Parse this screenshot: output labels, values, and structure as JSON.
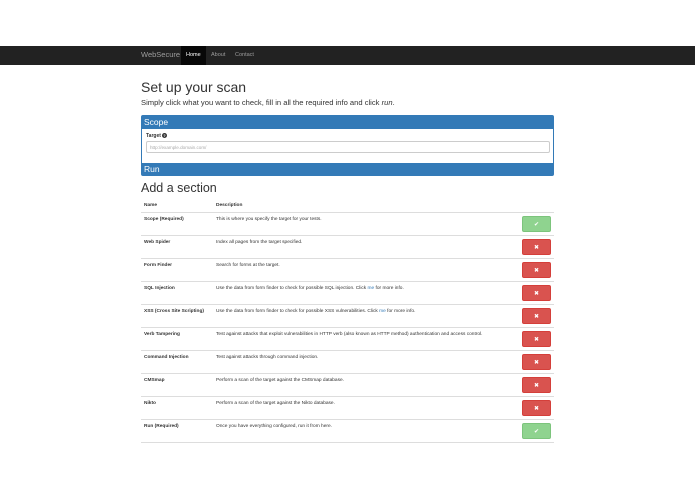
{
  "nav": {
    "brand": "WebSecure",
    "items": [
      {
        "label": "Home",
        "active": true
      },
      {
        "label": "About",
        "active": false
      },
      {
        "label": "Contact",
        "active": false
      }
    ]
  },
  "page": {
    "title": "Set up your scan",
    "lead_prefix": "Simply click what you want to check, fill in all the required info and click ",
    "lead_emphasis": "run",
    "lead_suffix": "."
  },
  "scope_panel": {
    "heading": "Scope",
    "target_label": "Target",
    "help_icon": "question-circle-icon",
    "target_placeholder": "http://example.domain.com/",
    "footer": "Run"
  },
  "sections": {
    "title": "Add a section",
    "col_name": "Name",
    "col_desc": "Description",
    "rows": [
      {
        "name": "Scope (Required)",
        "desc": "This is where you specify the target for your tests.",
        "desc_link": "",
        "desc_after": "",
        "enabled": true
      },
      {
        "name": "Web Spider",
        "desc": "Index all pages from the target specified.",
        "desc_link": "",
        "desc_after": "",
        "enabled": false
      },
      {
        "name": "Form Finder",
        "desc": "Search for forms at the target.",
        "desc_link": "",
        "desc_after": "",
        "enabled": false
      },
      {
        "name": "SQL Injection",
        "desc": "Use the data from form finder to check for possible SQL injection. Click ",
        "desc_link": "me",
        "desc_after": " for more info.",
        "enabled": false
      },
      {
        "name": "XSS (Cross Site Scripting)",
        "desc": "Use the data from form finder to check for possible XSS vulnerabilities. Click ",
        "desc_link": "me",
        "desc_after": " for more info.",
        "enabled": false
      },
      {
        "name": "Verb Tampering",
        "desc": "Test against attacks that exploit vulnerabilities in HTTP verb (also known as HTTP method) authentication and access control.",
        "desc_link": "",
        "desc_after": "",
        "enabled": false
      },
      {
        "name": "Command Injection",
        "desc": "Test against attacks through command injection.",
        "desc_link": "",
        "desc_after": "",
        "enabled": false
      },
      {
        "name": "CMSmap",
        "desc": "Perform a scan of the target against the CMSmap database.",
        "desc_link": "",
        "desc_after": "",
        "enabled": false
      },
      {
        "name": "Nikto",
        "desc": "Perform a scan of the target against the Nikto database.",
        "desc_link": "",
        "desc_after": "",
        "enabled": false
      },
      {
        "name": "Run (Required)",
        "desc": "Once you have everything configured, run it from here.",
        "desc_link": "",
        "desc_after": "",
        "enabled": true
      }
    ]
  },
  "icons": {
    "enabled": "check-icon",
    "disabled": "times-icon"
  },
  "colors": {
    "navbar": "#222222",
    "primary": "#337ab7",
    "success": "#8fd38f",
    "danger": "#d9534f"
  }
}
